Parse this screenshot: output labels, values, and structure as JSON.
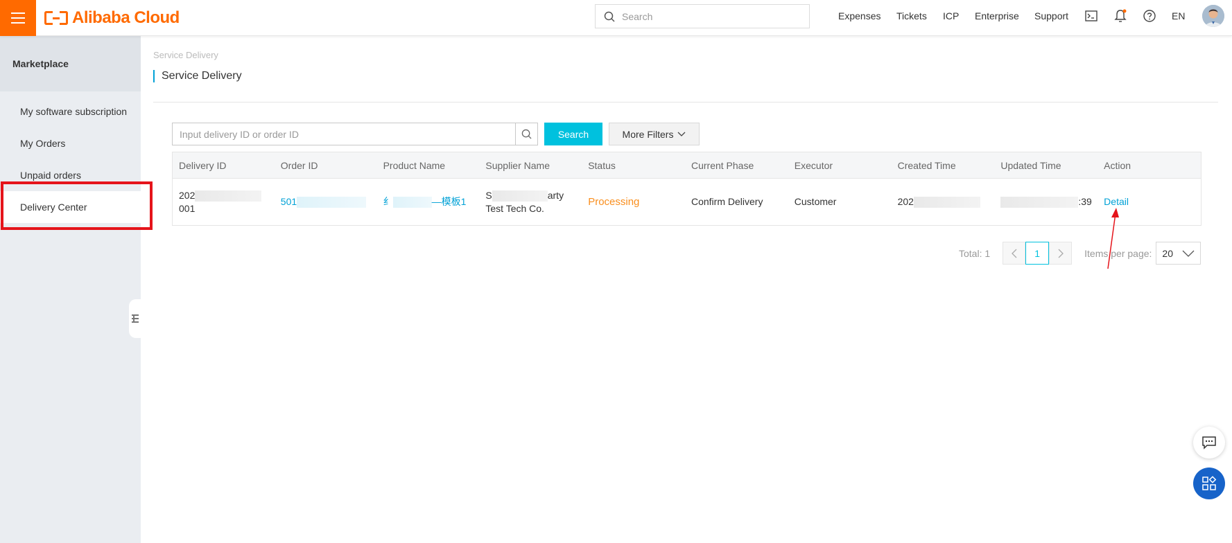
{
  "header": {
    "logo_text": "Alibaba Cloud",
    "search_placeholder": "Search",
    "nav": [
      "Expenses",
      "Tickets",
      "ICP",
      "Enterprise",
      "Support"
    ],
    "language": "EN",
    "brand_color": "#ff6a00"
  },
  "sidebar": {
    "title": "Marketplace",
    "items": [
      {
        "label": "My software subscription",
        "active": false
      },
      {
        "label": "My Orders",
        "active": false
      },
      {
        "label": "Unpaid orders",
        "active": false
      },
      {
        "label": "Delivery Center",
        "active": true
      }
    ]
  },
  "main": {
    "breadcrumb": "Service Delivery",
    "title": "Service Delivery",
    "filter": {
      "placeholder": "Input delivery ID or order ID",
      "search_label": "Search",
      "more_filters_label": "More Filters"
    },
    "table": {
      "columns": [
        "Delivery ID",
        "Order ID",
        "Product Name",
        "Supplier Name",
        "Status",
        "Current Phase",
        "Executor",
        "Created Time",
        "Updated Time",
        "Action"
      ],
      "rows": [
        {
          "delivery_id_line1": "202",
          "delivery_id_line2": "001",
          "order_id": "501",
          "product_name_start": "纟",
          "product_name_end": "—模板1",
          "supplier_line1_start": "S",
          "supplier_line1_end": "arty",
          "supplier_line2": "Test Tech Co.",
          "status": "Processing",
          "current_phase": "Confirm Delivery",
          "executor": "Customer",
          "created_time": "202",
          "updated_time": ":39",
          "action": "Detail"
        }
      ]
    },
    "pagination": {
      "total_label": "Total: 1",
      "current_page": "1",
      "items_per_page_label": "Items per page:",
      "page_size": "20"
    }
  }
}
